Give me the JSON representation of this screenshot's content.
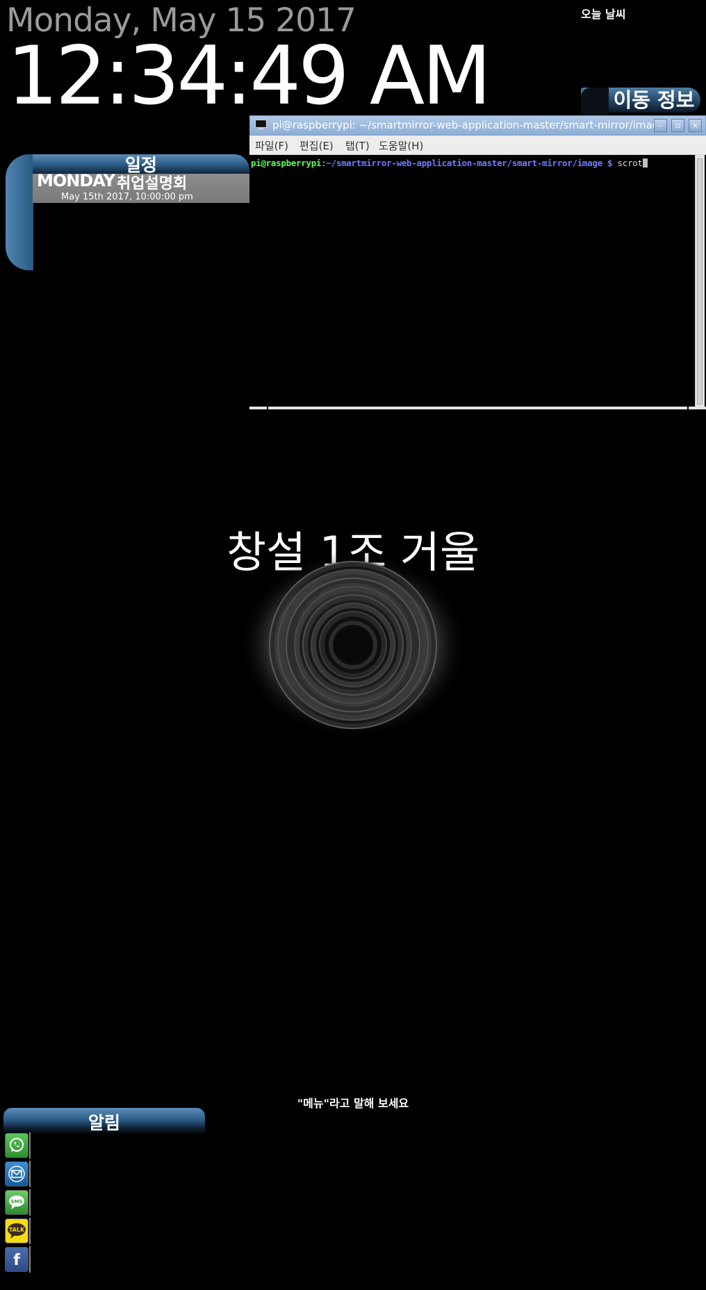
{
  "clock": {
    "date": "Monday, May 15 2017",
    "time": "12:34:49 AM"
  },
  "weather": {
    "label": "오늘 날씨"
  },
  "traffic": {
    "title": "이동 정보"
  },
  "schedule": {
    "title": "일정",
    "items": [
      {
        "day": "MONDAY",
        "event": "취업설명회",
        "datetime": "May 15th 2017, 10:00:00 pm"
      }
    ]
  },
  "terminal": {
    "title": "pi@raspberrypi: ~/smartmirror-web-application-master/smart-mirror/image",
    "menus": [
      "파일(F)",
      "편집(E)",
      "탭(T)",
      "도움말(H)"
    ],
    "prompt_user": "pi@raspberrypi",
    "prompt_sep": ":",
    "prompt_path": "~/smartmirror-web-application-master/smart-mirror/image $",
    "command": "scrot",
    "buttons": {
      "minimize": "–",
      "maximize": "▫",
      "close": "×"
    }
  },
  "mirror": {
    "title": "창설 1조 거울"
  },
  "voice": {
    "hint": "\"메뉴\"라고 말해 보세요"
  },
  "notifications": {
    "title": "알림",
    "apps": [
      {
        "icon": "whatsapp-icon",
        "label": "",
        "color": "#3fae3f"
      },
      {
        "icon": "mail-icon",
        "label": "",
        "color": "#1f6fb8"
      },
      {
        "icon": "sms-icon",
        "label": "SMS",
        "color": "#4cb04c"
      },
      {
        "icon": "kakaotalk-icon",
        "label": "TALK",
        "color": "#f7e01a"
      },
      {
        "icon": "facebook-icon",
        "label": "f",
        "color": "#3b5a9a"
      }
    ]
  },
  "colors": {
    "background": "#000000",
    "panel_blue": "#2a5a82",
    "schedule_item": "#808080",
    "term_user": "#5cff5c",
    "term_path": "#6f7dff"
  }
}
